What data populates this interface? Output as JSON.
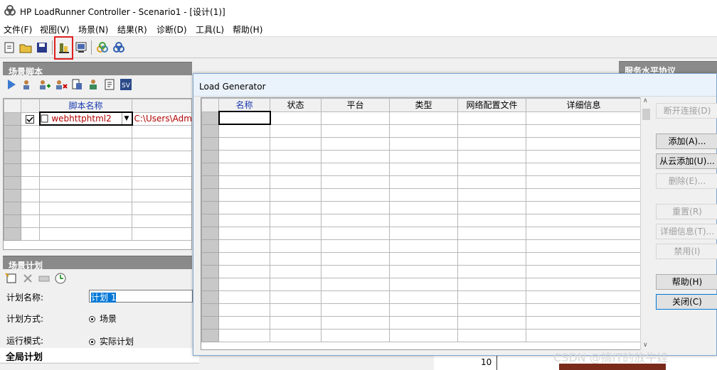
{
  "window": {
    "title": "HP LoadRunner Controller - Scenario1 - [设计(1)]"
  },
  "menu": [
    "文件(F)",
    "视图(V)",
    "场景(N)",
    "结果(R)",
    "诊断(D)",
    "工具(L)",
    "帮助(H)"
  ],
  "scripts_panel": {
    "title": "场景脚本",
    "columns": [
      "脚本名称"
    ],
    "rows": [
      {
        "checked": true,
        "name": "webhttphtml2",
        "path": "C:\\Users\\Adminis"
      }
    ]
  },
  "plan_panel": {
    "title": "场景计划",
    "name_label": "计划名称:",
    "name_value": "计划 1",
    "mode_label": "计划方式:",
    "mode_value": "场景",
    "run_label": "运行模式:",
    "run_value": "实际计划"
  },
  "global_plan": {
    "title": "全局计划"
  },
  "sla_panel": {
    "title": "服务水平协议"
  },
  "dialog": {
    "title": "Load Generator",
    "columns": [
      "名称",
      "状态",
      "平台",
      "类型",
      "网络配置文件",
      "详细信息"
    ],
    "buttons": {
      "disconnect": "断开连接(D)",
      "add": "添加(A)...",
      "add_cloud": "从云添加(U)...",
      "delete": "删除(E)...",
      "reset": "重置(R)",
      "details": "详细信息(T)...",
      "disable": "禁用(I)",
      "help": "帮助(H)",
      "close": "关闭(C)"
    }
  },
  "chart_axis": {
    "tick": "10"
  },
  "watermark": "CSDN @搞IT的放牛娃"
}
